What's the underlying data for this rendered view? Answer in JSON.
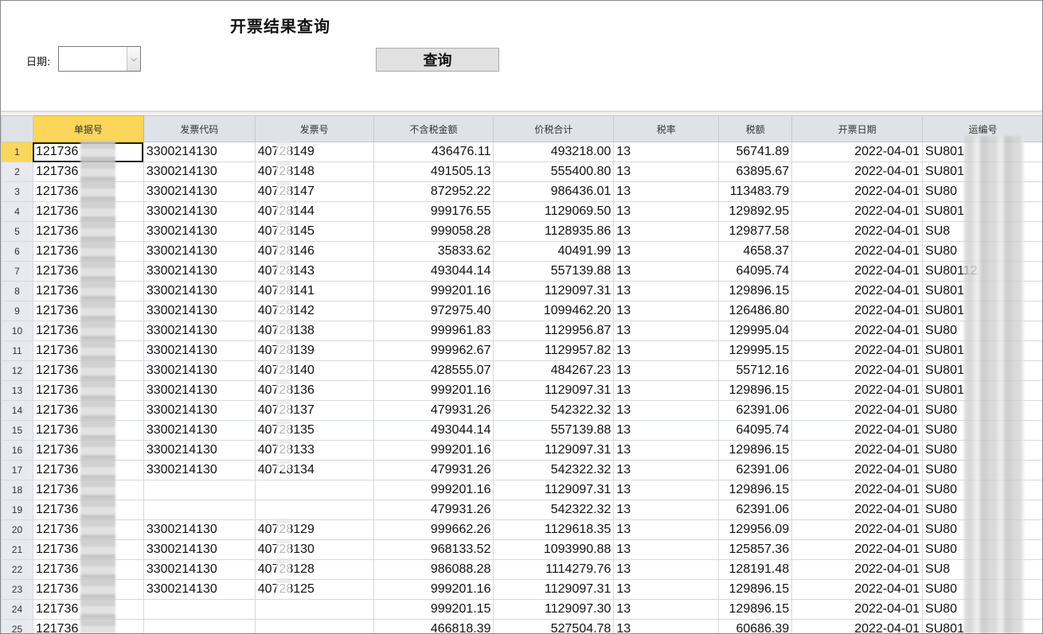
{
  "page": {
    "title": "开票结果查询"
  },
  "filter": {
    "date_label": "日期:",
    "date_value": "",
    "dropdown_glyph": "⌵"
  },
  "toolbar": {
    "query_label": "查询"
  },
  "colors": {
    "selected_header": "#fcd65a",
    "header_bg": "#dfe3e8"
  },
  "table": {
    "columns": [
      "单据号",
      "发票代码",
      "发票号",
      "不含税金额",
      "价税合计",
      "税率",
      "税额",
      "开票日期",
      "运编号"
    ],
    "rows": [
      {
        "n": "1",
        "doc": "121736",
        "code": "3300214130",
        "inv": "40728149",
        "amt": "436476.11",
        "total": "493218.00",
        "rate": "13",
        "tax": "56741.89",
        "date": "2022-04-01",
        "ship": "SU801"
      },
      {
        "n": "2",
        "doc": "121736",
        "code": "3300214130",
        "inv": "40728148",
        "amt": "491505.13",
        "total": "555400.80",
        "rate": "13",
        "tax": "63895.67",
        "date": "2022-04-01",
        "ship": "SU801"
      },
      {
        "n": "3",
        "doc": "121736",
        "code": "3300214130",
        "inv": "40728147",
        "amt": "872952.22",
        "total": "986436.01",
        "rate": "13",
        "tax": "113483.79",
        "date": "2022-04-01",
        "ship": "SU80"
      },
      {
        "n": "4",
        "doc": "121736",
        "code": "3300214130",
        "inv": "40728144",
        "amt": "999176.55",
        "total": "1129069.50",
        "rate": "13",
        "tax": "129892.95",
        "date": "2022-04-01",
        "ship": "SU801"
      },
      {
        "n": "5",
        "doc": "121736",
        "code": "3300214130",
        "inv": "40728145",
        "amt": "999058.28",
        "total": "1128935.86",
        "rate": "13",
        "tax": "129877.58",
        "date": "2022-04-01",
        "ship": "SU8"
      },
      {
        "n": "6",
        "doc": "121736",
        "code": "3300214130",
        "inv": "40728146",
        "amt": "35833.62",
        "total": "40491.99",
        "rate": "13",
        "tax": "4658.37",
        "date": "2022-04-01",
        "ship": "SU80"
      },
      {
        "n": "7",
        "doc": "121736",
        "code": "3300214130",
        "inv": "40728143",
        "amt": "493044.14",
        "total": "557139.88",
        "rate": "13",
        "tax": "64095.74",
        "date": "2022-04-01",
        "ship": "SU80112"
      },
      {
        "n": "8",
        "doc": "121736",
        "code": "3300214130",
        "inv": "40728141",
        "amt": "999201.16",
        "total": "1129097.31",
        "rate": "13",
        "tax": "129896.15",
        "date": "2022-04-01",
        "ship": "SU801"
      },
      {
        "n": "9",
        "doc": "121736",
        "code": "3300214130",
        "inv": "40728142",
        "amt": "972975.40",
        "total": "1099462.20",
        "rate": "13",
        "tax": "126486.80",
        "date": "2022-04-01",
        "ship": "SU801"
      },
      {
        "n": "10",
        "doc": "121736",
        "code": "3300214130",
        "inv": "40728138",
        "amt": "999961.83",
        "total": "1129956.87",
        "rate": "13",
        "tax": "129995.04",
        "date": "2022-04-01",
        "ship": "SU80"
      },
      {
        "n": "11",
        "doc": "121736",
        "code": "3300214130",
        "inv": "40728139",
        "amt": "999962.67",
        "total": "1129957.82",
        "rate": "13",
        "tax": "129995.15",
        "date": "2022-04-01",
        "ship": "SU801"
      },
      {
        "n": "12",
        "doc": "121736",
        "code": "3300214130",
        "inv": "40728140",
        "amt": "428555.07",
        "total": "484267.23",
        "rate": "13",
        "tax": "55712.16",
        "date": "2022-04-01",
        "ship": "SU801"
      },
      {
        "n": "13",
        "doc": "121736",
        "code": "3300214130",
        "inv": "40728136",
        "amt": "999201.16",
        "total": "1129097.31",
        "rate": "13",
        "tax": "129896.15",
        "date": "2022-04-01",
        "ship": "SU801"
      },
      {
        "n": "14",
        "doc": "121736",
        "code": "3300214130",
        "inv": "40728137",
        "amt": "479931.26",
        "total": "542322.32",
        "rate": "13",
        "tax": "62391.06",
        "date": "2022-04-01",
        "ship": "SU80"
      },
      {
        "n": "15",
        "doc": "121736",
        "code": "3300214130",
        "inv": "40728135",
        "amt": "493044.14",
        "total": "557139.88",
        "rate": "13",
        "tax": "64095.74",
        "date": "2022-04-01",
        "ship": "SU80"
      },
      {
        "n": "16",
        "doc": "121736",
        "code": "3300214130",
        "inv": "40728133",
        "amt": "999201.16",
        "total": "1129097.31",
        "rate": "13",
        "tax": "129896.15",
        "date": "2022-04-01",
        "ship": "SU80"
      },
      {
        "n": "17",
        "doc": "121736",
        "code": "3300214130",
        "inv": "40728134",
        "amt": "479931.26",
        "total": "542322.32",
        "rate": "13",
        "tax": "62391.06",
        "date": "2022-04-01",
        "ship": "SU80"
      },
      {
        "n": "18",
        "doc": "121736",
        "code": "",
        "inv": "",
        "amt": "999201.16",
        "total": "1129097.31",
        "rate": "13",
        "tax": "129896.15",
        "date": "2022-04-01",
        "ship": "SU80"
      },
      {
        "n": "19",
        "doc": "121736",
        "code": "",
        "inv": "",
        "amt": "479931.26",
        "total": "542322.32",
        "rate": "13",
        "tax": "62391.06",
        "date": "2022-04-01",
        "ship": "SU80"
      },
      {
        "n": "20",
        "doc": "121736",
        "code": "3300214130",
        "inv": "40728129",
        "amt": "999662.26",
        "total": "1129618.35",
        "rate": "13",
        "tax": "129956.09",
        "date": "2022-04-01",
        "ship": "SU80"
      },
      {
        "n": "21",
        "doc": "121736",
        "code": "3300214130",
        "inv": "40728130",
        "amt": "968133.52",
        "total": "1093990.88",
        "rate": "13",
        "tax": "125857.36",
        "date": "2022-04-01",
        "ship": "SU80"
      },
      {
        "n": "22",
        "doc": "121736",
        "code": "3300214130",
        "inv": "40728128",
        "amt": "986088.28",
        "total": "1114279.76",
        "rate": "13",
        "tax": "128191.48",
        "date": "2022-04-01",
        "ship": "SU8"
      },
      {
        "n": "23",
        "doc": "121736",
        "code": "3300214130",
        "inv": "40728125",
        "amt": "999201.16",
        "total": "1129097.31",
        "rate": "13",
        "tax": "129896.15",
        "date": "2022-04-01",
        "ship": "SU80"
      },
      {
        "n": "24",
        "doc": "121736",
        "code": "",
        "inv": "",
        "amt": "999201.15",
        "total": "1129097.30",
        "rate": "13",
        "tax": "129896.15",
        "date": "2022-04-01",
        "ship": "SU80"
      },
      {
        "n": "25",
        "doc": "121736",
        "code": "",
        "inv": "",
        "amt": "466818.39",
        "total": "527504.78",
        "rate": "13",
        "tax": "60686.39",
        "date": "2022-04-01",
        "ship": "SU801"
      }
    ]
  }
}
